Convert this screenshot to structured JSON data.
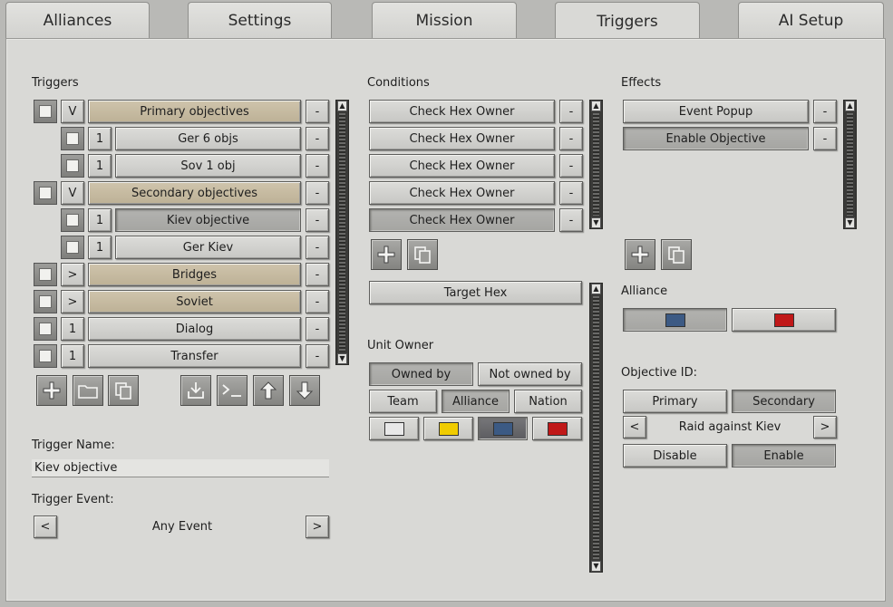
{
  "tabs": [
    "Alliances",
    "Settings",
    "Mission",
    "Triggers",
    "AI Setup"
  ],
  "active_tab": "Triggers",
  "triggers": {
    "header": "Triggers",
    "rows": [
      {
        "toggle": "V",
        "label": "Primary objectives",
        "type": "group"
      },
      {
        "toggle": "1",
        "label": "Ger 6 objs",
        "type": "child"
      },
      {
        "toggle": "1",
        "label": "Sov 1 obj",
        "type": "child"
      },
      {
        "toggle": "V",
        "label": "Secondary objectives",
        "type": "group"
      },
      {
        "toggle": "1",
        "label": "Kiev objective",
        "type": "child-selected"
      },
      {
        "toggle": "1",
        "label": "Ger Kiev",
        "type": "child"
      },
      {
        "toggle": ">",
        "label": "Bridges",
        "type": "group"
      },
      {
        "toggle": ">",
        "label": "Soviet",
        "type": "group"
      },
      {
        "toggle": "1",
        "label": "Dialog",
        "type": "item"
      },
      {
        "toggle": "1",
        "label": "Transfer",
        "type": "item"
      }
    ],
    "remove_label": "-",
    "name_label": "Trigger Name:",
    "name_value": "Kiev objective",
    "event_label": "Trigger Event:",
    "event_value": "Any Event",
    "prev": "<",
    "next": ">"
  },
  "conditions": {
    "header": "Conditions",
    "rows": [
      "Check Hex Owner",
      "Check Hex Owner",
      "Check Hex Owner",
      "Check Hex Owner",
      "Check Hex Owner"
    ],
    "target_hex": "Target Hex",
    "unit_owner_label": "Unit Owner",
    "owned_by": "Owned by",
    "not_owned_by": "Not owned by",
    "team": "Team",
    "alliance": "Alliance",
    "nation": "Nation",
    "colors": [
      "#e8e8e8",
      "#f0cc00",
      "#3c5a84",
      "#c01818"
    ]
  },
  "effects": {
    "header": "Effects",
    "rows": [
      "Event Popup",
      "Enable Objective"
    ],
    "alliance_label": "Alliance",
    "alliance_colors": [
      "#3c5a84",
      "#c01818"
    ],
    "objective_label": "Objective ID:",
    "primary": "Primary",
    "secondary": "Secondary",
    "objective_name": "Raid against Kiev",
    "prev": "<",
    "next": ">",
    "disable": "Disable",
    "enable": "Enable"
  }
}
